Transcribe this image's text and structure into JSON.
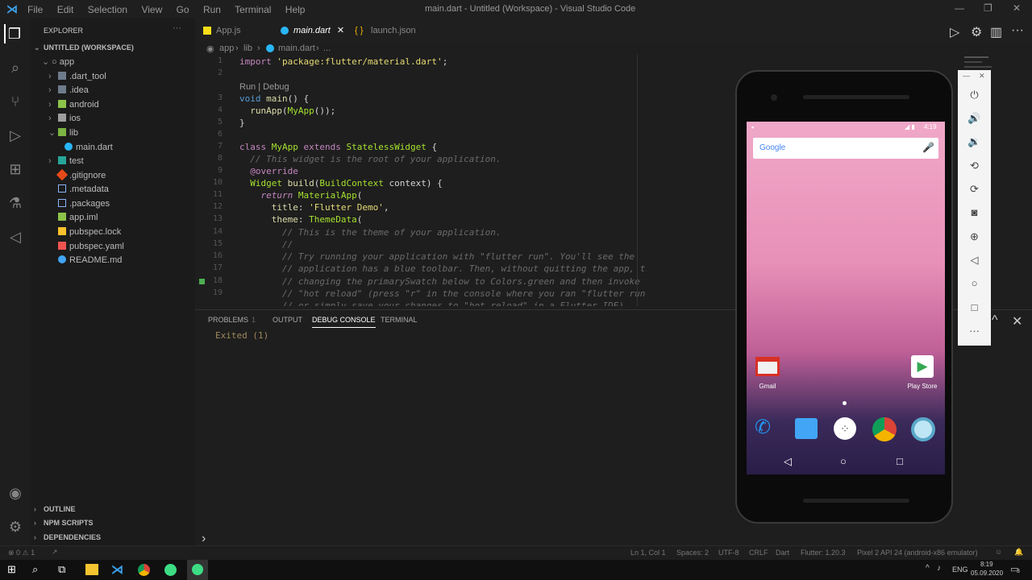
{
  "window": {
    "title": "main.dart - Untitled (Workspace) - Visual Studio Code"
  },
  "menu": [
    "File",
    "Edit",
    "Selection",
    "View",
    "Go",
    "Run",
    "Terminal",
    "Help"
  ],
  "explorer": {
    "header": "EXPLORER",
    "workspace": "UNTITLED (WORKSPACE)",
    "root": "app",
    "items": [
      ".dart_tool",
      ".idea",
      "android",
      "ios",
      "lib",
      "main.dart",
      "test",
      ".gitignore",
      ".metadata",
      ".packages",
      "app.iml",
      "pubspec.lock",
      "pubspec.yaml",
      "README.md"
    ],
    "sections": [
      "OUTLINE",
      "NPM SCRIPTS",
      "DEPENDENCIES"
    ]
  },
  "tabs": [
    "App.js",
    "main.dart",
    "launch.json"
  ],
  "breadcrumb": [
    "app",
    "lib",
    "main.dart",
    "..."
  ],
  "editor": {
    "codelens": "Run | Debug",
    "line_numbers": [
      "1",
      "2",
      "3",
      "4",
      "5",
      "6",
      "7",
      "8",
      "9",
      "10",
      "11",
      "12",
      "13",
      "14",
      "15",
      "16",
      "17",
      "18",
      "19"
    ]
  },
  "panel": {
    "tabs": [
      "PROBLEMS",
      "OUTPUT",
      "DEBUG CONSOLE",
      "TERMINAL"
    ],
    "problems_count": "1",
    "output": "Exited (1)"
  },
  "status": {
    "left": [
      "⊗ 0 ⚠ 1"
    ],
    "right": [
      "Ln 1, Col 1",
      "Spaces: 2",
      "UTF-8",
      "CRLF",
      "Dart",
      "Flutter: 1.20.3",
      "Pixel 2 API 24 (android-x86 emulator)"
    ]
  },
  "phone": {
    "time": "4:19",
    "search": "Google",
    "apps": [
      "Gmail",
      "Play Store"
    ]
  },
  "taskbar": {
    "lang": "ENG",
    "time": "8:19",
    "date": "05.09.2020",
    "notif": "3"
  },
  "colors": {
    "accent": "#0e70c0",
    "bg": "#1e1e1e"
  }
}
